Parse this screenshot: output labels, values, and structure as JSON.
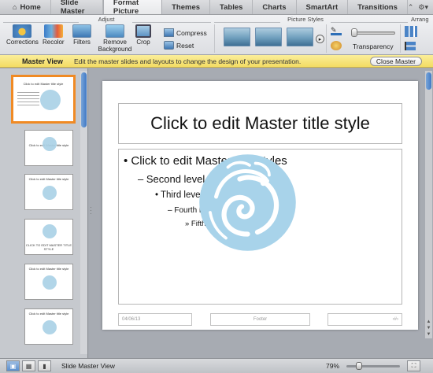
{
  "tabs": [
    {
      "label": "Home"
    },
    {
      "label": "Slide Master"
    },
    {
      "label": "Format Picture"
    },
    {
      "label": "Themes"
    },
    {
      "label": "Tables"
    },
    {
      "label": "Charts"
    },
    {
      "label": "SmartArt"
    },
    {
      "label": "Transitions"
    }
  ],
  "tab_active": "Format Picture",
  "ribbon": {
    "groups": {
      "adjust": "Adjust",
      "picture_styles": "Picture Styles",
      "arrange": "Arrang"
    },
    "tools": {
      "corrections": "Corrections",
      "recolor": "Recolor",
      "filters": "Filters",
      "remove_background": "Remove Background",
      "crop": "Crop",
      "compress": "Compress",
      "reset": "Reset",
      "transparency": "Transparency"
    }
  },
  "master_bar": {
    "title": "Master View",
    "description": "Edit the master slides and layouts to change the design of your presentation.",
    "close_label": "Close Master"
  },
  "thumbnails": [
    {
      "label": "Click to edit Master title style"
    },
    {
      "label": "Click to edit Master title style"
    },
    {
      "label": "Click to edit Master title style"
    },
    {
      "label": "CLICK TO EDIT MASTER TITLE STYLE"
    },
    {
      "label": "Click to edit Master title style"
    },
    {
      "label": "Click to edit Master title style"
    }
  ],
  "slide": {
    "title": "Click to edit Master title style",
    "levels": [
      "• Click to edit Master text styles",
      "– Second level",
      "• Third level",
      "– Fourth level",
      "» Fifth level"
    ],
    "footer_date": "04/06/13",
    "footer_text": "Footer",
    "footer_num": "‹#›"
  },
  "status": {
    "view_label": "Slide Master View",
    "zoom": "79%"
  },
  "colors": {
    "accent": "#f08a24",
    "master_bar": "#f6e27a",
    "logo": "#a8d3ea"
  }
}
